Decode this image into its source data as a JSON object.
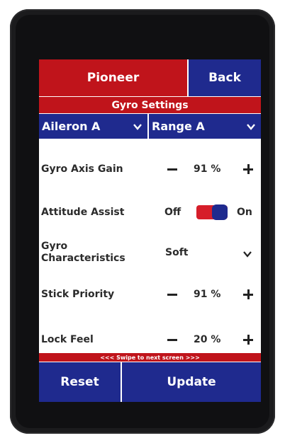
{
  "header": {
    "title": "Pioneer",
    "back_label": "Back"
  },
  "section": {
    "title": "Gyro Settings"
  },
  "selectors": {
    "aileron": "Aileron A",
    "range": "Range A"
  },
  "rows": {
    "gyro_axis_gain": {
      "label": "Gyro Axis Gain",
      "value": "91 %"
    },
    "attitude_assist": {
      "label": "Attitude Assist",
      "off_label": "Off",
      "on_label": "On",
      "state": "on"
    },
    "gyro_characteristics": {
      "label_line1": "Gyro",
      "label_line2": "Characteristics",
      "value": "Soft"
    },
    "stick_priority": {
      "label": "Stick Priority",
      "value": "91 %"
    },
    "lock_feel": {
      "label": "Lock Feel",
      "value": "20 %"
    }
  },
  "swipe_hint": "<<< Swipe to next screen >>>",
  "footer": {
    "reset_label": "Reset",
    "update_label": "Update"
  },
  "colors": {
    "red": "#c0141b",
    "blue": "#1f2a8e",
    "toggle_red": "#d61e2a"
  },
  "icons": [
    "chevron-down-icon",
    "minus-icon",
    "plus-icon",
    "toggle-switch"
  ]
}
